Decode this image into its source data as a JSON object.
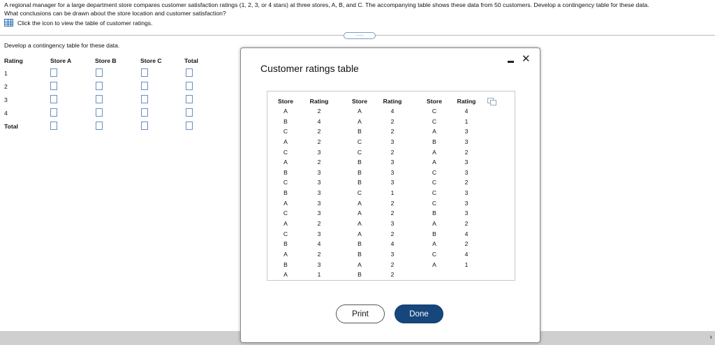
{
  "question": {
    "line1": "A regional manager for a large department store compares customer satisfaction ratings (1, 2, 3, or 4 stars) at three stores, A, B, and C. The accompanying table shows these data from 50 customers. Develop a contingency table for these data.",
    "line2": "What conclusions can be drawn about the store location and customer satisfaction?",
    "link_text": "Click the icon to view the table of customer ratings."
  },
  "divider_pill": "......",
  "contingency": {
    "prompt": "Develop a contingency table for these data.",
    "headers": [
      "Rating",
      "Store A",
      "Store B",
      "Store C",
      "Total"
    ],
    "rows": [
      "1",
      "2",
      "3",
      "4",
      "Total"
    ]
  },
  "dialog": {
    "title": "Customer ratings table",
    "col_headers": [
      "Store",
      "Rating",
      "Store",
      "Rating",
      "Store",
      "Rating"
    ],
    "col1_store": [
      "A",
      "B",
      "C",
      "A",
      "C",
      "A",
      "B",
      "C",
      "B",
      "A",
      "C",
      "A",
      "C",
      "B",
      "A",
      "B",
      "A"
    ],
    "col1_rating": [
      "2",
      "4",
      "2",
      "2",
      "3",
      "2",
      "3",
      "3",
      "3",
      "3",
      "3",
      "2",
      "3",
      "4",
      "2",
      "3",
      "1"
    ],
    "col2_store": [
      "A",
      "A",
      "B",
      "C",
      "C",
      "B",
      "B",
      "B",
      "C",
      "A",
      "A",
      "A",
      "A",
      "B",
      "B",
      "A",
      "B"
    ],
    "col2_rating": [
      "4",
      "2",
      "2",
      "3",
      "2",
      "3",
      "3",
      "3",
      "1",
      "2",
      "2",
      "3",
      "2",
      "4",
      "3",
      "2",
      "2"
    ],
    "col3_store": [
      "C",
      "C",
      "A",
      "B",
      "A",
      "A",
      "C",
      "C",
      "C",
      "C",
      "B",
      "A",
      "B",
      "A",
      "C",
      "A"
    ],
    "col3_rating": [
      "4",
      "1",
      "3",
      "3",
      "2",
      "3",
      "3",
      "2",
      "3",
      "3",
      "3",
      "2",
      "4",
      "2",
      "4",
      "1"
    ],
    "print_label": "Print",
    "done_label": "Done",
    "minimize_glyph": "—",
    "close_glyph": "✕"
  },
  "colors": {
    "accent": "#17467d",
    "box_border": "#6a8fbf"
  }
}
